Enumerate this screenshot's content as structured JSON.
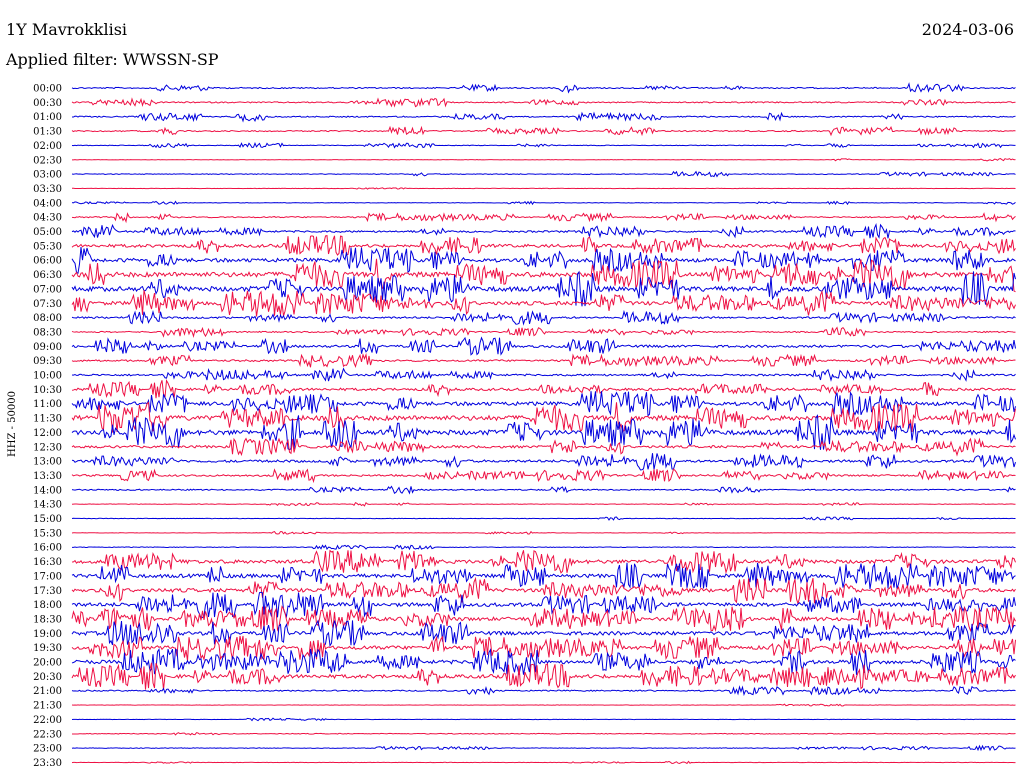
{
  "header": {
    "station": "1Y Mavrokklisi",
    "date": "2024-03-06",
    "filter": "Applied filter: WWSSN-SP"
  },
  "chart_data": {
    "type": "line",
    "title": "1Y Mavrokklisi",
    "ylabel": "HHZ - 50000",
    "x_minutes": [
      0,
      30
    ],
    "colors": {
      "blue": "#0000dd",
      "red": "#ee1144"
    },
    "rows": [
      {
        "label": "00:00",
        "amp": 1
      },
      {
        "label": "00:30",
        "amp": 1
      },
      {
        "label": "01:00",
        "amp": 1
      },
      {
        "label": "01:30",
        "amp": 1
      },
      {
        "label": "02:00",
        "amp": 0.5
      },
      {
        "label": "02:30",
        "amp": 0.3
      },
      {
        "label": "03:00",
        "amp": 0.6
      },
      {
        "label": "03:30",
        "amp": 0.3
      },
      {
        "label": "04:00",
        "amp": 0.4
      },
      {
        "label": "04:30",
        "amp": 1
      },
      {
        "label": "05:00",
        "amp": 1.5
      },
      {
        "label": "05:30",
        "amp": 2.5
      },
      {
        "label": "06:00",
        "amp": 3
      },
      {
        "label": "06:30",
        "amp": 4
      },
      {
        "label": "07:00",
        "amp": 4
      },
      {
        "label": "07:30",
        "amp": 3
      },
      {
        "label": "08:00",
        "amp": 1.5
      },
      {
        "label": "08:30",
        "amp": 1
      },
      {
        "label": "09:00",
        "amp": 2
      },
      {
        "label": "09:30",
        "amp": 1.5
      },
      {
        "label": "10:00",
        "amp": 1.5
      },
      {
        "label": "10:30",
        "amp": 2
      },
      {
        "label": "11:00",
        "amp": 3
      },
      {
        "label": "11:30",
        "amp": 4
      },
      {
        "label": "12:00",
        "amp": 4
      },
      {
        "label": "12:30",
        "amp": 2
      },
      {
        "label": "13:00",
        "amp": 2
      },
      {
        "label": "13:30",
        "amp": 1.5
      },
      {
        "label": "14:00",
        "amp": 1
      },
      {
        "label": "14:30",
        "amp": 0.4
      },
      {
        "label": "15:00",
        "amp": 0.4
      },
      {
        "label": "15:30",
        "amp": 0.3
      },
      {
        "label": "16:00",
        "amp": 0.5
      },
      {
        "label": "16:30",
        "amp": 3
      },
      {
        "label": "17:00",
        "amp": 3
      },
      {
        "label": "17:30",
        "amp": 3
      },
      {
        "label": "18:00",
        "amp": 3
      },
      {
        "label": "18:30",
        "amp": 3
      },
      {
        "label": "19:00",
        "amp": 3
      },
      {
        "label": "19:30",
        "amp": 3
      },
      {
        "label": "20:00",
        "amp": 3
      },
      {
        "label": "20:30",
        "amp": 3
      },
      {
        "label": "21:00",
        "amp": 1
      },
      {
        "label": "21:30",
        "amp": 0.3
      },
      {
        "label": "22:00",
        "amp": 0.3
      },
      {
        "label": "22:30",
        "amp": 0.6
      },
      {
        "label": "23:00",
        "amp": 0.5
      },
      {
        "label": "23:30",
        "amp": 0.3
      }
    ]
  }
}
